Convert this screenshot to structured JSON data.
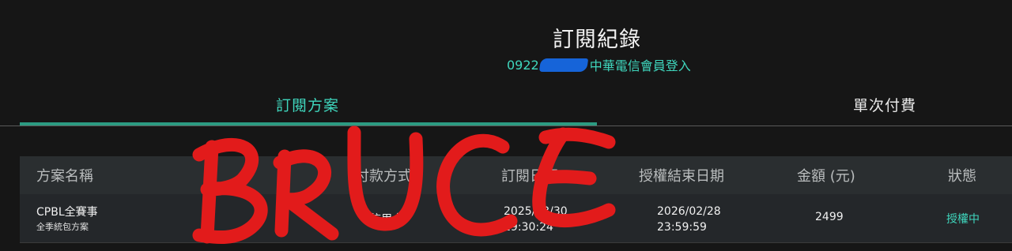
{
  "header": {
    "title": "訂閱紀錄",
    "phone_prefix": "0922",
    "login_text": "中華電信會員登入"
  },
  "tabs": [
    {
      "label": "訂閱方案",
      "active": true
    },
    {
      "label": "單次付費",
      "active": false
    }
  ],
  "table": {
    "columns": [
      "方案名稱",
      "付款方式",
      "訂閱日期",
      "授權結束日期",
      "金額 (元)",
      "狀態"
    ],
    "rows": [
      {
        "plan_name": "CPBL全賽事",
        "plan_sub": "全季統包方案",
        "pay_method": "信用卡",
        "sub_date": "2025/03/30",
        "sub_time": "19:30:24",
        "end_date": "2026/02/28",
        "end_time": "23:59:59",
        "amount": "2499",
        "status": "授權中"
      }
    ]
  },
  "overlay": {
    "graffiti_text": "BRUCE",
    "graffiti_color": "#e21b1b",
    "redaction_color": "#1664d9"
  },
  "colors": {
    "accent": "#3fd6bd",
    "tab_underline": "#2c9b82",
    "background": "#161616"
  }
}
